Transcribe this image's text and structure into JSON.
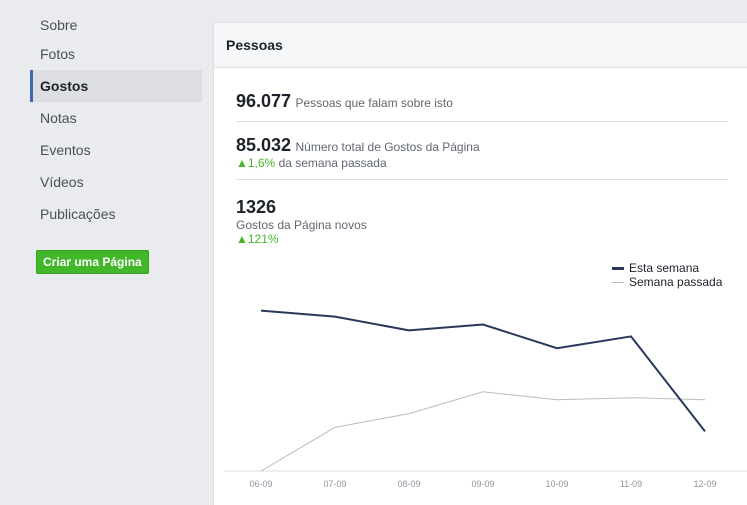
{
  "sidebar": {
    "items": [
      {
        "label": "Sobre"
      },
      {
        "label": "Fotos"
      },
      {
        "label": "Gostos"
      },
      {
        "label": "Notas"
      },
      {
        "label": "Eventos"
      },
      {
        "label": "Vídeos"
      },
      {
        "label": "Publicações"
      }
    ],
    "active_index": 2,
    "create_page_label": "Criar uma Página"
  },
  "panel": {
    "title": "Pessoas",
    "talking": {
      "value": "96.077",
      "label": "Pessoas que falam sobre isto"
    },
    "total_likes": {
      "value": "85.032",
      "label": "Número total de Gostos da Página",
      "change": "▲1,6%",
      "change_text": " da semana passada"
    },
    "new_likes": {
      "value": "1326",
      "label": "Gostos da Página novos",
      "change": "▲121%"
    }
  },
  "chart_data": {
    "type": "line",
    "categories": [
      "06-09",
      "07-09",
      "08-09",
      "09-09",
      "10-09",
      "11-09",
      "12-09"
    ],
    "series": [
      {
        "name": "Esta semana",
        "values": [
          81,
          78,
          71,
          74,
          62,
          68,
          20
        ],
        "color": "#29385c"
      },
      {
        "name": "Semana passada",
        "values": [
          0,
          22,
          29,
          40,
          36,
          37,
          36
        ],
        "color": "#bbbbbb"
      }
    ],
    "ylim": [
      0,
      100
    ],
    "legend_position": "top-right",
    "grid": false
  }
}
